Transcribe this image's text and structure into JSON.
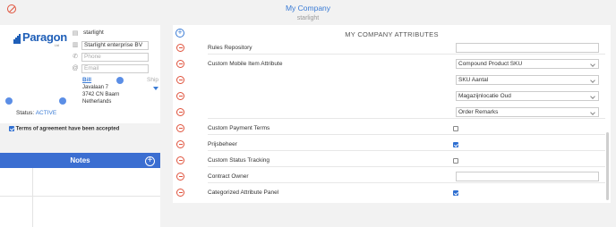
{
  "header": {
    "title": "My Company",
    "subtitle": "starlight"
  },
  "icons": {
    "status": "no-entry-icon",
    "add": "plus-circle-icon",
    "remove": "minus-circle-icon"
  },
  "colors": {
    "accent": "#3a7bd5",
    "notes_bar": "#3b6ed1",
    "remove": "#e0533d",
    "logo_blue": "#1f5fb8",
    "logo_orange": "#f29b1e"
  },
  "company": {
    "logo": "Paragon",
    "logo_suffix": "Ltd",
    "name": "starlight",
    "legal_name": "Starlight enterprise BV",
    "phone_placeholder": "Phone",
    "email_placeholder": "Email",
    "bill_label": "Bill",
    "ship_label": "Ship",
    "address": [
      "Javalaan 7",
      "3742 CN Baarn",
      "Netherlands"
    ],
    "status_label": "Status:",
    "status_value": "ACTIVE",
    "terms_checked": true,
    "terms_label": "Terms of agreement have been accepted"
  },
  "notes": {
    "title": "Notes"
  },
  "attributes": {
    "title": "MY COMPANY ATTRIBUTES",
    "rows": [
      {
        "label": "Rules Repository",
        "kind": "text",
        "value": ""
      },
      {
        "label": "Custom Mobile Item Attribute",
        "kind": "select",
        "value": "Compound Product SKU"
      },
      {
        "label": "",
        "kind": "select",
        "value": "SKU Aantal"
      },
      {
        "label": "",
        "kind": "select",
        "value": "Magazijnlocatie Oud"
      },
      {
        "label": "",
        "kind": "select",
        "value": "Order Remarks"
      },
      {
        "label": "Custom Payment Terms",
        "kind": "checkbox",
        "checked": false
      },
      {
        "label": "Prijsbeheer",
        "kind": "checkbox",
        "checked": true
      },
      {
        "label": "Custom Status Tracking",
        "kind": "checkbox",
        "checked": false
      },
      {
        "label": "Contract Owner",
        "kind": "text",
        "value": ""
      },
      {
        "label": "Categorized Attribute Panel",
        "kind": "checkbox",
        "checked": true
      }
    ]
  }
}
